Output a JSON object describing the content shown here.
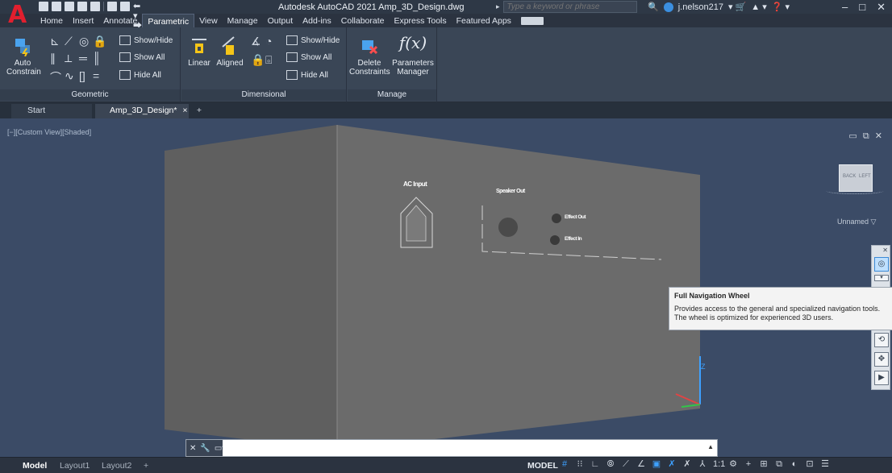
{
  "app": {
    "logo": "A",
    "title": "Autodesk AutoCAD 2021   Amp_3D_Design.dwg",
    "undo_glyph": "⬅ ▾ ⮕ ▾ ▾"
  },
  "search": {
    "placeholder": "Type a keyword or phrase"
  },
  "user": {
    "name": "j.nelson217"
  },
  "ribbon_tabs": [
    "Home",
    "Insert",
    "Annotate",
    "Parametric",
    "View",
    "Manage",
    "Output",
    "Add-ins",
    "Collaborate",
    "Express Tools",
    "Featured Apps"
  ],
  "active_tab": "Parametric",
  "panels": {
    "geometric": {
      "title": "Geometric",
      "auto_constrain": "Auto Constrain",
      "show_hide": "Show/Hide",
      "show_all": "Show All",
      "hide_all": "Hide All"
    },
    "dimensional": {
      "title": "Dimensional",
      "linear": "Linear",
      "aligned": "Aligned",
      "show_hide": "Show/Hide",
      "show_all": "Show All",
      "hide_all": "Hide All"
    },
    "manage": {
      "title": "Manage",
      "delete_constraints": "Delete Constraints",
      "parameters_manager": "Parameters Manager",
      "fx": "f(x)"
    }
  },
  "doc_tabs": {
    "start": "Start",
    "file": "Amp_3D_Design*",
    "close": "×",
    "add": "+"
  },
  "viewport": {
    "label": "[−][Custom View][Shaded]",
    "controls": "▭ ⧉ ✕",
    "viewcube_left": "BACK",
    "viewcube_right": "LEFT",
    "ucs_name": "Unnamed ▽",
    "model_labels": {
      "ac_input": "AC Input",
      "speaker_out": "Speaker Out",
      "effect_out": "Effect Out",
      "effect_in": "Effect In"
    }
  },
  "tooltip": {
    "title": "Full Navigation Wheel",
    "line1": "Provides access to the general and specialized navigation tools.",
    "line2": "The wheel is optimized for experienced 3D users."
  },
  "command_line": {
    "placeholder": ""
  },
  "status_bar": {
    "tabs": [
      "Model",
      "Layout1",
      "Layout2"
    ],
    "active_tab": "Model",
    "add": "+",
    "model_label": "MODEL",
    "scale": "1:1"
  },
  "colors": {
    "accent": "#3ea1ff",
    "viewport_bg": "#3b4b66",
    "ribbon_bg": "#3a4656",
    "model_face": "#6b6b6b"
  }
}
